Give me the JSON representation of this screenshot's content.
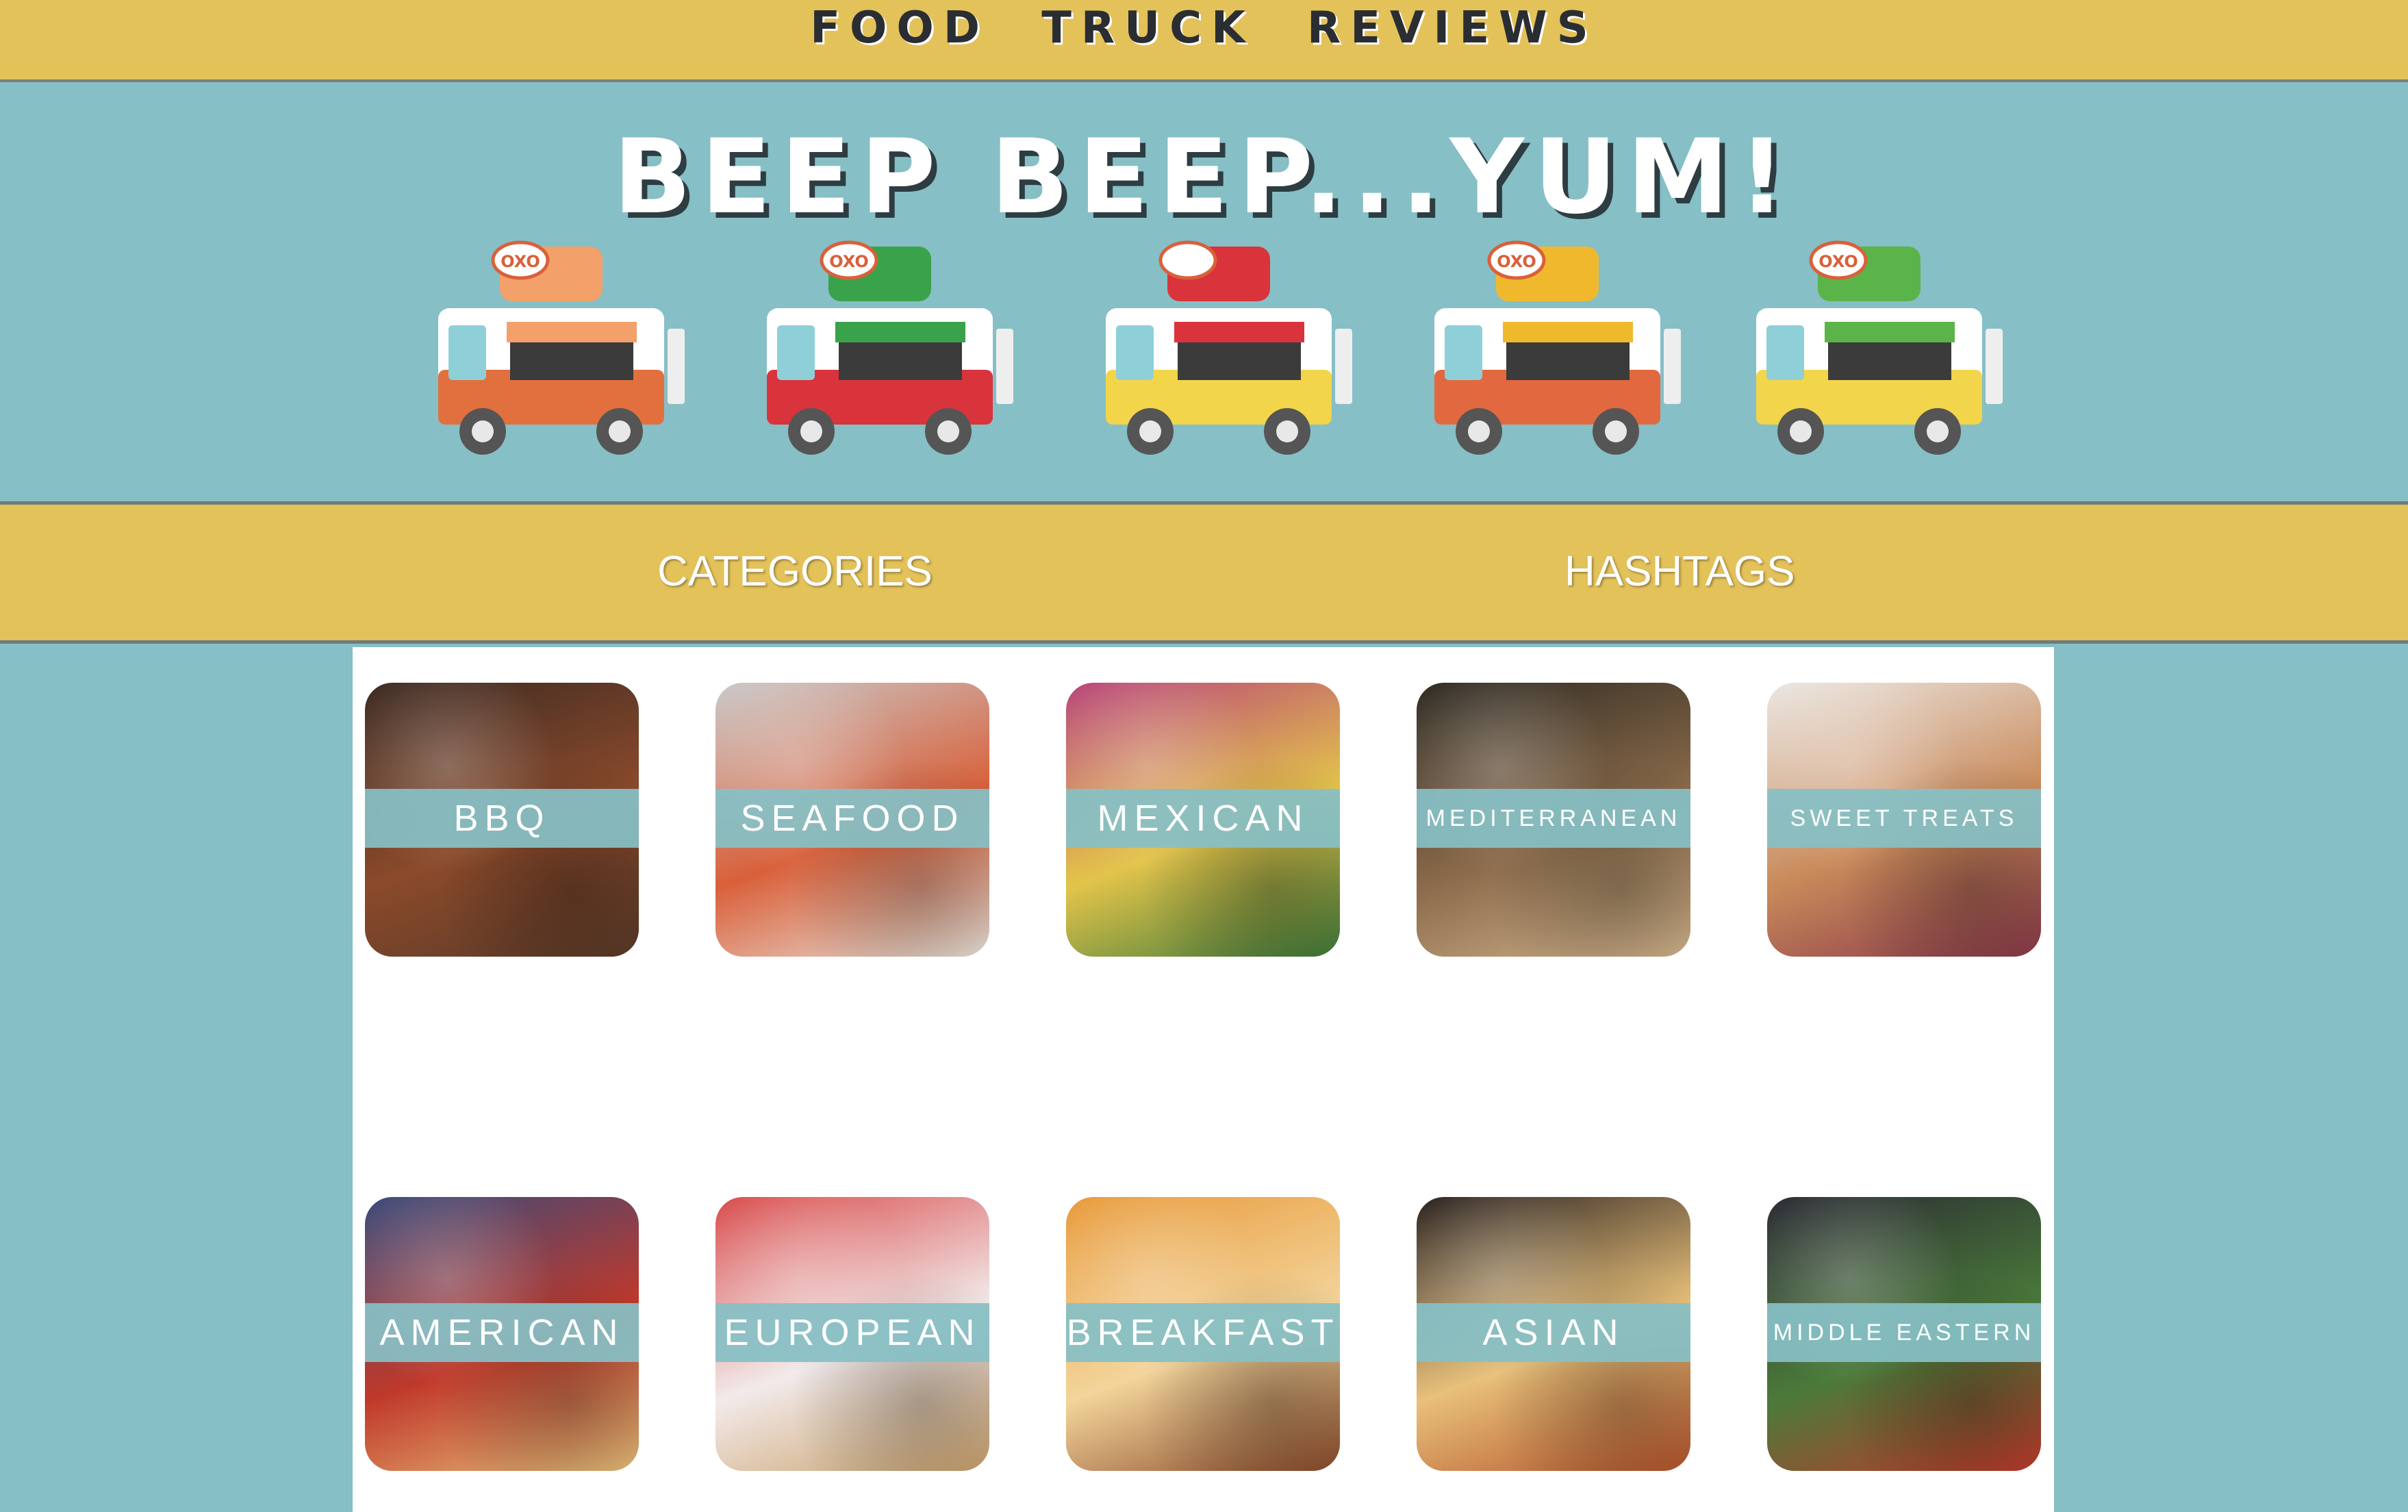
{
  "header": {
    "site_title": "FOOD TRUCK REVIEWS"
  },
  "hero": {
    "title": "BEEP BEEP...YUM!",
    "trucks": [
      {
        "name": "sushi-truck",
        "roof_sign": "OXO",
        "body": "#e2703f",
        "accent": "#f3a06a"
      },
      {
        "name": "pizza-truck",
        "roof_sign": "OXO",
        "body": "#d9343b",
        "accent": "#3aa24a"
      },
      {
        "name": "burger-truck",
        "roof_sign": "",
        "body": "#f2d54a",
        "accent": "#d9343b"
      },
      {
        "name": "dumpling-truck",
        "roof_sign": "OXO",
        "body": "#e2683f",
        "accent": "#f0b92d"
      },
      {
        "name": "taco-truck",
        "roof_sign": "OXO",
        "body": "#f2d54a",
        "accent": "#5bb44a"
      }
    ]
  },
  "nav": {
    "categories": "CATEGORIES",
    "hashtags": "HASHTAGS"
  },
  "categories": [
    {
      "label": "BBQ",
      "colors": [
        "#3c2a22",
        "#8b4a2b",
        "#5a3a28"
      ]
    },
    {
      "label": "SEAFOOD",
      "colors": [
        "#c9c9c9",
        "#d9603a",
        "#e8e3da"
      ]
    },
    {
      "label": "MEXICAN",
      "colors": [
        "#b8447a",
        "#e3c44a",
        "#3e7a3a"
      ]
    },
    {
      "label": "MEDITERRANEAN",
      "colors": [
        "#2e2a22",
        "#8a6a4a",
        "#d2b48c"
      ]
    },
    {
      "label": "SWEET TREATS",
      "colors": [
        "#ebe7e3",
        "#c98a5a",
        "#8a3a4a"
      ]
    },
    {
      "label": "AMERICAN",
      "colors": [
        "#3a4a7a",
        "#c0392b",
        "#e8c07a"
      ]
    },
    {
      "label": "EUROPEAN",
      "colors": [
        "#d94a4a",
        "#f2eaea",
        "#c9a06a"
      ]
    },
    {
      "label": "BREAKFAST",
      "colors": [
        "#e89a3a",
        "#f3d49a",
        "#8a4a2a"
      ]
    },
    {
      "label": "ASIAN",
      "colors": [
        "#2a2220",
        "#e8c07a",
        "#b4532a"
      ]
    },
    {
      "label": "MIDDLE EASTERN",
      "colors": [
        "#2a2a33",
        "#4a7a3a",
        "#c0392b"
      ]
    }
  ]
}
